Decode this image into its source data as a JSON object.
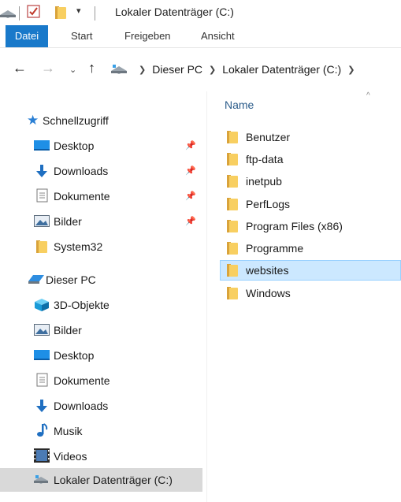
{
  "window": {
    "title": "Lokaler Datenträger (C:)"
  },
  "ribbon": {
    "tabs": [
      {
        "label": "Datei"
      },
      {
        "label": "Start"
      },
      {
        "label": "Freigeben"
      },
      {
        "label": "Ansicht"
      }
    ]
  },
  "address": {
    "breadcrumb": [
      "Dieser PC",
      "Lokaler Datenträger (C:)"
    ]
  },
  "navpane": {
    "quick_access": {
      "label": "Schnellzugriff",
      "items": [
        {
          "label": "Desktop",
          "icon": "desktop-icon",
          "pinned": true
        },
        {
          "label": "Downloads",
          "icon": "download-icon",
          "pinned": true
        },
        {
          "label": "Dokumente",
          "icon": "document-icon",
          "pinned": true
        },
        {
          "label": "Bilder",
          "icon": "pictures-icon",
          "pinned": true
        },
        {
          "label": "System32",
          "icon": "folder-icon",
          "pinned": false
        }
      ]
    },
    "this_pc": {
      "label": "Dieser PC",
      "items": [
        {
          "label": "3D-Objekte",
          "icon": "3d-objects-icon"
        },
        {
          "label": "Bilder",
          "icon": "pictures-icon"
        },
        {
          "label": "Desktop",
          "icon": "desktop-icon"
        },
        {
          "label": "Dokumente",
          "icon": "document-icon"
        },
        {
          "label": "Downloads",
          "icon": "download-icon"
        },
        {
          "label": "Musik",
          "icon": "music-icon"
        },
        {
          "label": "Videos",
          "icon": "video-icon"
        },
        {
          "label": "Lokaler Datenträger (C:)",
          "icon": "drive-icon",
          "selected": true
        }
      ]
    }
  },
  "content": {
    "column_header": "Name",
    "files": [
      {
        "name": "Benutzer"
      },
      {
        "name": "ftp-data"
      },
      {
        "name": "inetpub"
      },
      {
        "name": "PerfLogs"
      },
      {
        "name": "Program Files (x86)"
      },
      {
        "name": "Programme"
      },
      {
        "name": "websites",
        "selected": true
      },
      {
        "name": "Windows"
      }
    ]
  },
  "colors": {
    "accent": "#1979ca",
    "selection_bg": "#cce8ff",
    "selection_border": "#99d1ff",
    "nav_selected": "#d9d9d9",
    "folder": "#f8cf61"
  }
}
